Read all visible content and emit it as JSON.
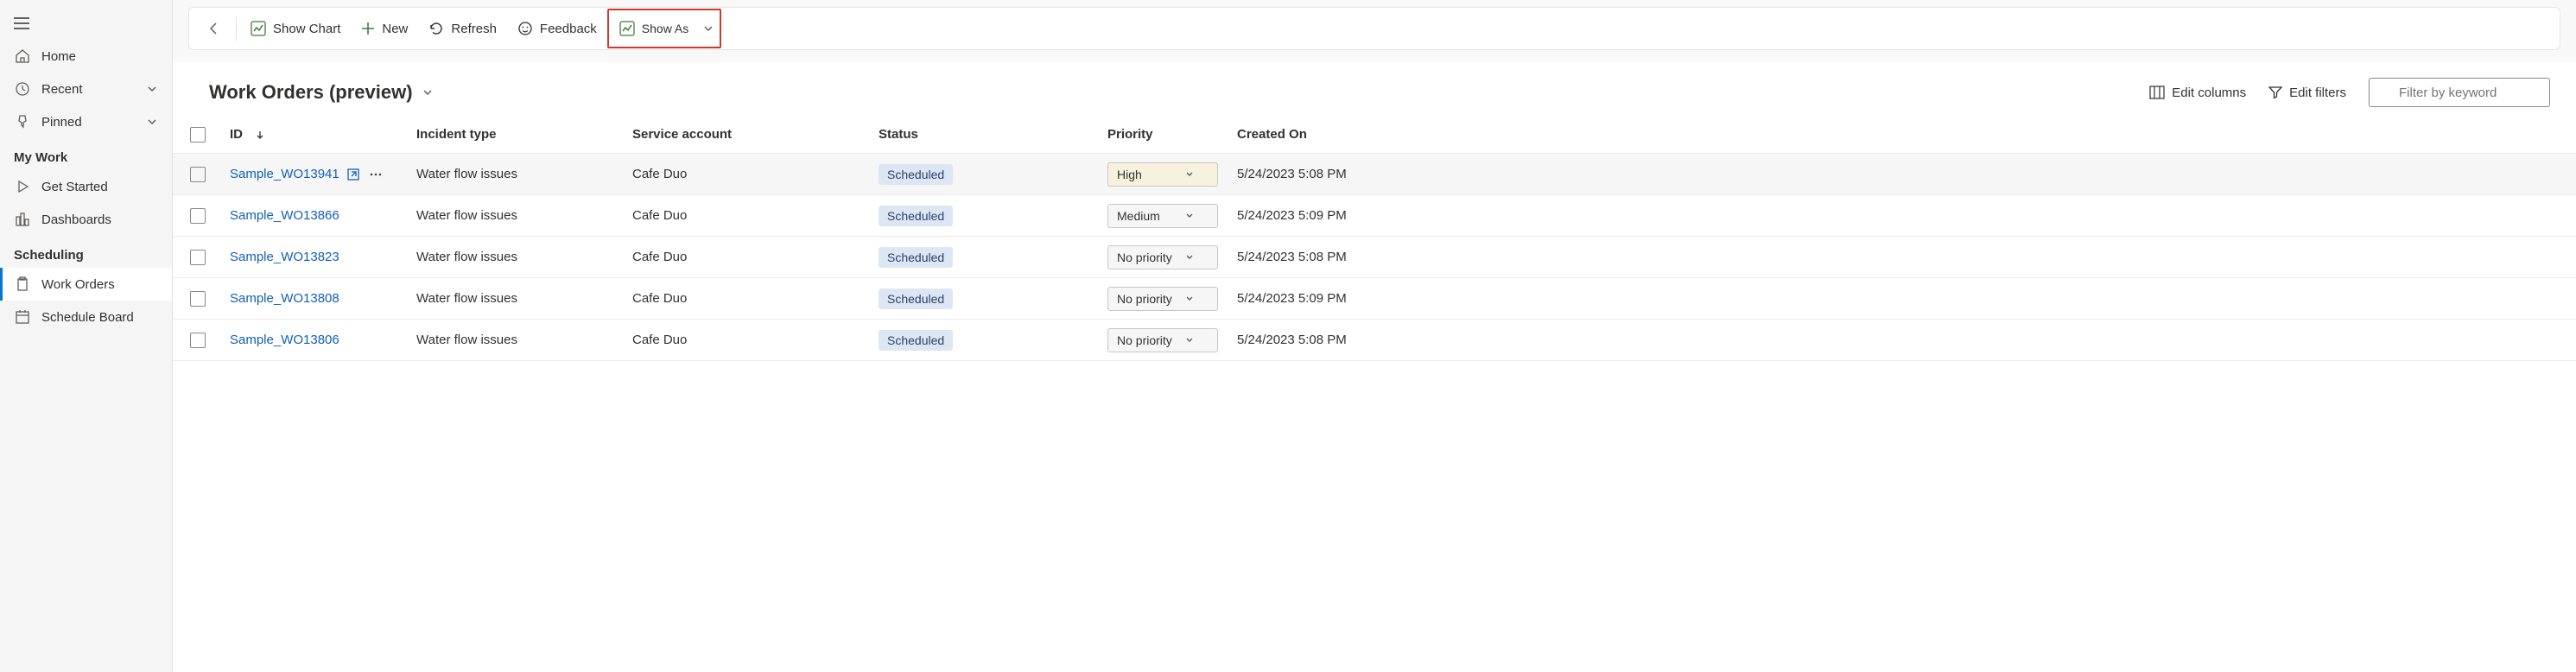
{
  "sidebar": {
    "top": [
      {
        "label": "Home",
        "icon": "home"
      },
      {
        "label": "Recent",
        "icon": "clock",
        "expandable": true
      },
      {
        "label": "Pinned",
        "icon": "pin",
        "expandable": true
      }
    ],
    "groups": [
      {
        "label": "My Work",
        "items": [
          {
            "label": "Get Started",
            "icon": "play"
          },
          {
            "label": "Dashboards",
            "icon": "grid"
          }
        ]
      },
      {
        "label": "Scheduling",
        "items": [
          {
            "label": "Work Orders",
            "icon": "clipboard",
            "selected": true
          },
          {
            "label": "Schedule Board",
            "icon": "calendar"
          }
        ]
      }
    ]
  },
  "commandBar": {
    "showChart": "Show Chart",
    "new": "New",
    "refresh": "Refresh",
    "feedback": "Feedback",
    "showAs": "Show As"
  },
  "view": {
    "title": "Work Orders (preview)",
    "editColumns": "Edit columns",
    "editFilters": "Edit filters",
    "filterPlaceholder": "Filter by keyword"
  },
  "table": {
    "columns": {
      "id": "ID",
      "incident": "Incident type",
      "service": "Service account",
      "status": "Status",
      "priority": "Priority",
      "created": "Created On"
    },
    "rows": [
      {
        "id": "Sample_WO13941",
        "incident": "Water flow issues",
        "service": "Cafe Duo",
        "status": "Scheduled",
        "priority": "High",
        "priorityClass": "high",
        "created": "5/24/2023 5:08 PM",
        "hovered": true
      },
      {
        "id": "Sample_WO13866",
        "incident": "Water flow issues",
        "service": "Cafe Duo",
        "status": "Scheduled",
        "priority": "Medium",
        "priorityClass": "",
        "created": "5/24/2023 5:09 PM"
      },
      {
        "id": "Sample_WO13823",
        "incident": "Water flow issues",
        "service": "Cafe Duo",
        "status": "Scheduled",
        "priority": "No priority",
        "priorityClass": "",
        "created": "5/24/2023 5:08 PM"
      },
      {
        "id": "Sample_WO13808",
        "incident": "Water flow issues",
        "service": "Cafe Duo",
        "status": "Scheduled",
        "priority": "No priority",
        "priorityClass": "",
        "created": "5/24/2023 5:09 PM"
      },
      {
        "id": "Sample_WO13806",
        "incident": "Water flow issues",
        "service": "Cafe Duo",
        "status": "Scheduled",
        "priority": "No priority",
        "priorityClass": "",
        "created": "5/24/2023 5:08 PM"
      }
    ]
  }
}
